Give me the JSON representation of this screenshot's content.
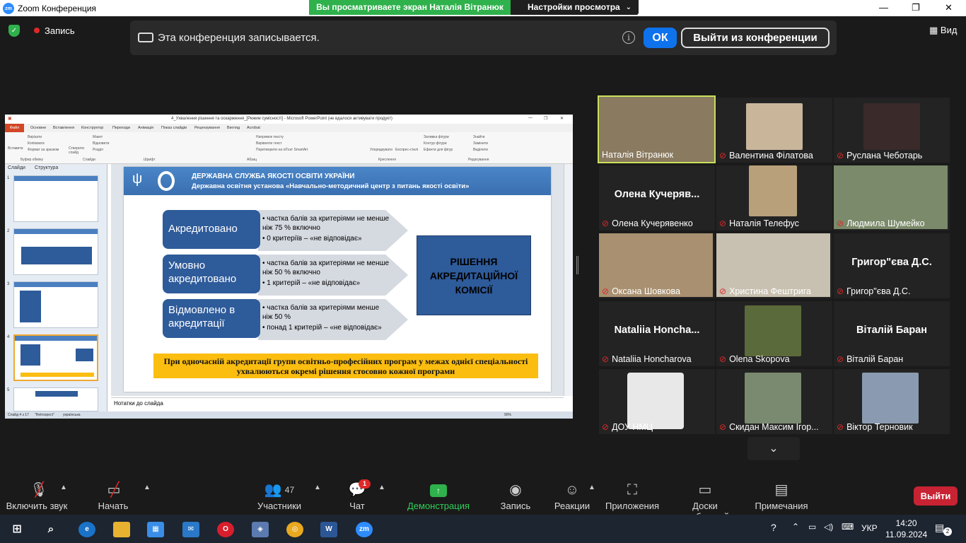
{
  "window": {
    "title": "Zoom Конференция",
    "logo": "zm",
    "minimize_icon": "—",
    "maximize_icon": "❐",
    "close_icon": "✕"
  },
  "share_banner": {
    "viewing": "Вы просматриваете экран Наталія Вітранюк",
    "view_options": "Настройки просмотра"
  },
  "top": {
    "recording_label": "Запись",
    "view_label": "Вид",
    "shield": "✓"
  },
  "recording_notice": {
    "text": "Эта конференция записывается.",
    "ok": "ОК",
    "leave": "Выйти из конференции",
    "info": "i"
  },
  "powerpoint": {
    "title": "4_Ухвалення рішення та оскарження_[Режим сумісності] - Microsoft PowerPoint (не вдалося активувати продукт)",
    "file_tab": "Файл",
    "tabs": [
      "Основне",
      "Вставлення",
      "Конструктор",
      "Переходи",
      "Анімація",
      "Показ слайдів",
      "Рецензування",
      "Вигляд",
      "Acrobat"
    ],
    "ribbon": [
      "Вирізати",
      "Копіювати",
      "Формат за зразком",
      "Вставити",
      "Створити слайд",
      "Макет",
      "Відновити",
      "Розділ",
      "Буфер обміну",
      "Слайди",
      "Шрифт",
      "Абзац",
      "Напрямок тексту",
      "Вирівняти текст",
      "Перетворити на об'єкт SmartArt",
      "Упорядкувати",
      "Експрес-стилі",
      "Заливка фігури",
      "Контур фігури",
      "Ефекти для фігур",
      "Креслення",
      "Знайти",
      "Замінити",
      "Виділити",
      "Редагування"
    ],
    "panel_tabs": [
      "Слайди",
      "Структура"
    ],
    "notes": "Нотатки до слайда",
    "status": [
      "Слайд 4 з 17",
      "\"Retrospect\"",
      "українська",
      "90%"
    ],
    "slide": {
      "header1": "ДЕРЖАВНА СЛУЖБА ЯКОСТІ ОСВІТИ УКРАЇНИ",
      "header2": "Державна освітня установа «Навчально-методичний центр з питань якості освіти»",
      "boxes": [
        "Акредитовано",
        "Умовно акредитовано",
        "Відмовлено в акредитації"
      ],
      "bullets": [
        [
          "частка балів за критеріями не менше ніж 75 % включно",
          "0 критеріїв – «не відповідає»"
        ],
        [
          "частка балів за критеріями не менше ніж 50 % включно",
          " 1 критерій – «не відповідає»"
        ],
        [
          "частка балів за критеріями менше ніж 50 %",
          "понад 1 критерій – «не відповідає»"
        ]
      ],
      "decision": "РІШЕННЯ АКРЕДИТАЦІЙНОЇ КОМІСІЇ",
      "footer": "При одночасній акредитації групи освітньо-професійних програм у межах однієї спеціальності ухвалюються окремі рішення стосовно кожної програми"
    },
    "thumbnails": [
      "1",
      "2",
      "3",
      "4",
      "5"
    ]
  },
  "participants": [
    {
      "name": "Наталія Вітранюк",
      "muted": false,
      "active": true,
      "photo_color": "#8a7a60"
    },
    {
      "name": "Валентина Філатова",
      "muted": true,
      "photo_color": "#c9b59a"
    },
    {
      "name": "Руслана Чеботарь",
      "muted": true,
      "photo_color": "#3a2a2a"
    },
    {
      "name": "Олена Кучерявенко",
      "muted": true,
      "display": "Олена  Кучеряв..."
    },
    {
      "name": "Наталія Телефус",
      "muted": true,
      "photo_color": "#b8a07a"
    },
    {
      "name": "Людмила Шумейко",
      "muted": true,
      "photo_color": "#7a8a6a"
    },
    {
      "name": "Оксана Шовкова",
      "muted": true,
      "photo_color": "#a89070"
    },
    {
      "name": "Христина Фештрига",
      "muted": true,
      "photo_color": "#c8c0b0"
    },
    {
      "name": "Григор\"єва Д.С.",
      "muted": true,
      "display": "Григор\"єва Д.С."
    },
    {
      "name": "Nataliia Honcharova",
      "muted": true,
      "display": "Nataliia  Honcha..."
    },
    {
      "name": "Olena Skopova",
      "muted": true,
      "photo_color": "#5a6a3a"
    },
    {
      "name": "Віталій Баран",
      "muted": true,
      "display": "Віталій Баран"
    },
    {
      "name": "ДОУ НМЦ",
      "muted": true,
      "photo_color": "#e8e8e8"
    },
    {
      "name": "Скидан Максим Ігор...",
      "muted": true,
      "photo_color": "#7a8a70"
    },
    {
      "name": "Віктор Терновик",
      "muted": true,
      "photo_color": "#8a9ab0"
    }
  ],
  "gallery_more": "⌄",
  "controls": {
    "unmute": "Включить звук",
    "video": "Начать видео",
    "participants": "Участники",
    "participants_count": "47",
    "chat": "Чат",
    "chat_badge": "1",
    "share": "Демонстрация экрана",
    "record": "Запись",
    "reactions": "Реакции",
    "apps": "Приложения",
    "whiteboards": "Доски сообщений",
    "notes": "Примечания",
    "leave": "Выйти"
  },
  "taskbar": {
    "time": "14:20",
    "date": "11.09.2024",
    "lang": "УКР",
    "notifications": "2"
  }
}
